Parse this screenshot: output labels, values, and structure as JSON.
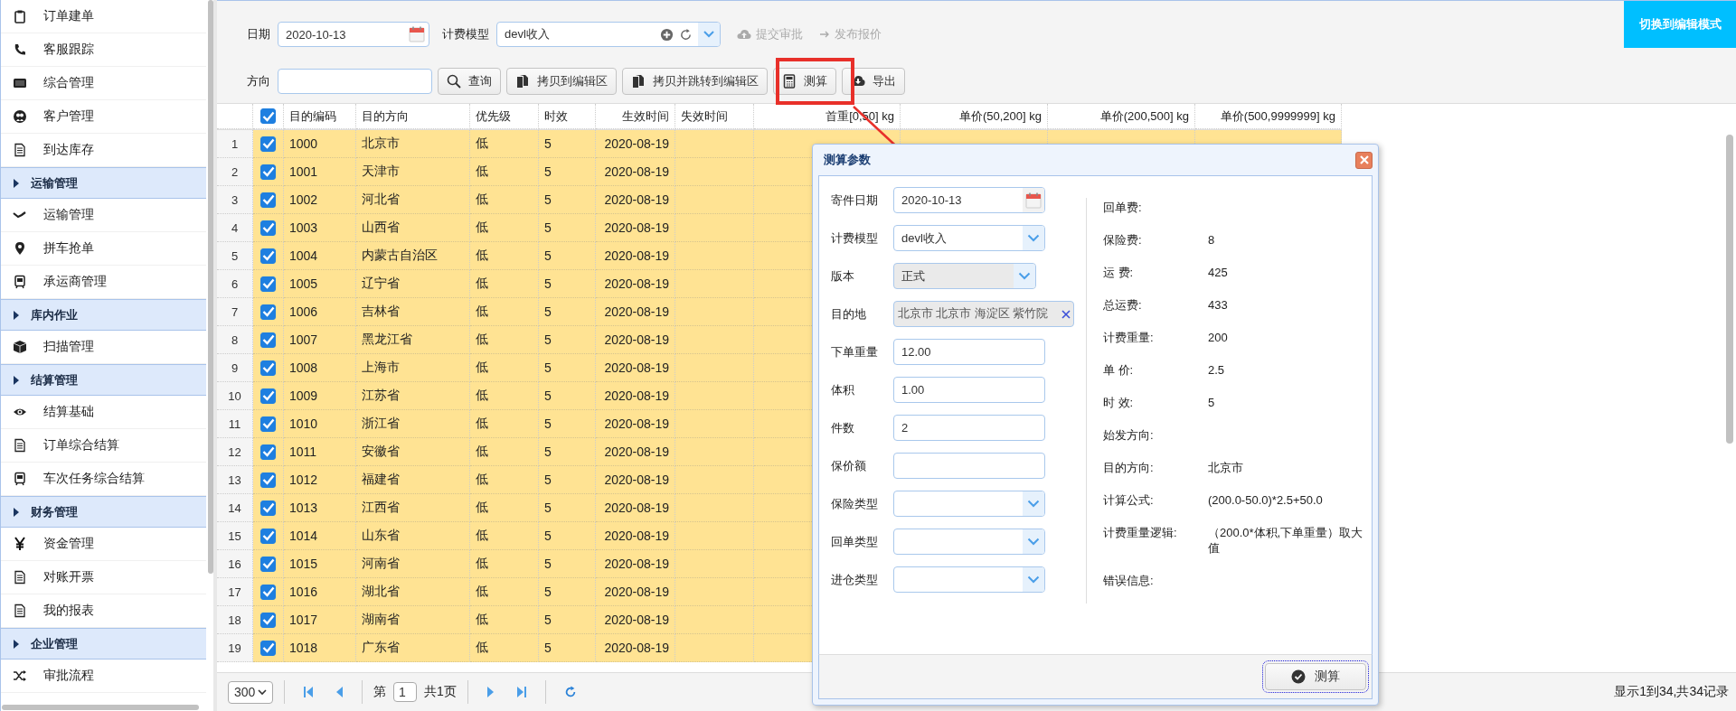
{
  "sidebar": {
    "items": [
      {
        "kind": "link",
        "label": "订单建单"
      },
      {
        "kind": "link",
        "label": "客服跟踪"
      },
      {
        "kind": "link",
        "label": "综合管理"
      },
      {
        "kind": "link",
        "label": "客户管理"
      },
      {
        "kind": "link",
        "label": "到达库存"
      },
      {
        "kind": "header",
        "label": "运输管理"
      },
      {
        "kind": "link",
        "label": "运输管理"
      },
      {
        "kind": "link",
        "label": "拼车抢单"
      },
      {
        "kind": "link",
        "label": "承运商管理"
      },
      {
        "kind": "header",
        "label": "库内作业"
      },
      {
        "kind": "link",
        "label": "扫描管理"
      },
      {
        "kind": "header",
        "label": "结算管理"
      },
      {
        "kind": "link",
        "label": "结算基础"
      },
      {
        "kind": "link",
        "label": "订单综合结算"
      },
      {
        "kind": "link",
        "label": "车次任务综合结算"
      },
      {
        "kind": "header",
        "label": "财务管理"
      },
      {
        "kind": "link",
        "label": "资金管理"
      },
      {
        "kind": "link",
        "label": "对账开票"
      },
      {
        "kind": "link",
        "label": "我的报表"
      },
      {
        "kind": "header",
        "label": "企业管理"
      },
      {
        "kind": "link",
        "label": "审批流程"
      }
    ]
  },
  "toolbar": {
    "date": {
      "label": "日期",
      "value": "2020-10-13"
    },
    "fee_model": {
      "label": "计费模型",
      "value": "devl收入"
    },
    "actions": [
      {
        "label": "提交审批",
        "disabled": true
      },
      {
        "label": "发布报价",
        "disabled": true
      }
    ],
    "direction": {
      "label": "方向"
    },
    "buttons": [
      {
        "label": "查询"
      },
      {
        "label": "拷贝到编辑区"
      },
      {
        "label": "拷贝并跳转到编辑区"
      },
      {
        "label": "测算",
        "highlighted": true
      },
      {
        "label": "导出"
      }
    ],
    "mode_button": "切换到编辑模式"
  },
  "table": {
    "select_all": true,
    "columns": [
      "目的编码",
      "目的方向",
      "优先级",
      "时效",
      "生效时间",
      "失效时间",
      "首重[0,50] kg",
      "单价(50,200] kg",
      "单价(200,500] kg",
      "单价(500,9999999] kg"
    ],
    "rows": [
      {
        "num": "1",
        "checked": true,
        "cells": [
          "1000",
          "北京市",
          "低",
          "5",
          "2020-08-19"
        ]
      },
      {
        "num": "2",
        "checked": true,
        "cells": [
          "1001",
          "天津市",
          "低",
          "5",
          "2020-08-19"
        ]
      },
      {
        "num": "3",
        "checked": true,
        "cells": [
          "1002",
          "河北省",
          "低",
          "5",
          "2020-08-19"
        ]
      },
      {
        "num": "4",
        "checked": true,
        "cells": [
          "1003",
          "山西省",
          "低",
          "5",
          "2020-08-19"
        ]
      },
      {
        "num": "5",
        "checked": true,
        "cells": [
          "1004",
          "内蒙古自治区",
          "低",
          "5",
          "2020-08-19"
        ]
      },
      {
        "num": "6",
        "checked": true,
        "cells": [
          "1005",
          "辽宁省",
          "低",
          "5",
          "2020-08-19"
        ]
      },
      {
        "num": "7",
        "checked": true,
        "cells": [
          "1006",
          "吉林省",
          "低",
          "5",
          "2020-08-19"
        ]
      },
      {
        "num": "8",
        "checked": true,
        "cells": [
          "1007",
          "黑龙江省",
          "低",
          "5",
          "2020-08-19"
        ]
      },
      {
        "num": "9",
        "checked": true,
        "cells": [
          "1008",
          "上海市",
          "低",
          "5",
          "2020-08-19"
        ]
      },
      {
        "num": "10",
        "checked": true,
        "cells": [
          "1009",
          "江苏省",
          "低",
          "5",
          "2020-08-19"
        ]
      },
      {
        "num": "11",
        "checked": true,
        "cells": [
          "1010",
          "浙江省",
          "低",
          "5",
          "2020-08-19"
        ]
      },
      {
        "num": "12",
        "checked": true,
        "cells": [
          "1011",
          "安徽省",
          "低",
          "5",
          "2020-08-19"
        ]
      },
      {
        "num": "13",
        "checked": true,
        "cells": [
          "1012",
          "福建省",
          "低",
          "5",
          "2020-08-19"
        ]
      },
      {
        "num": "14",
        "checked": true,
        "cells": [
          "1013",
          "江西省",
          "低",
          "5",
          "2020-08-19"
        ]
      },
      {
        "num": "15",
        "checked": true,
        "cells": [
          "1014",
          "山东省",
          "低",
          "5",
          "2020-08-19"
        ]
      },
      {
        "num": "16",
        "checked": true,
        "cells": [
          "1015",
          "河南省",
          "低",
          "5",
          "2020-08-19"
        ]
      },
      {
        "num": "17",
        "checked": true,
        "cells": [
          "1016",
          "湖北省",
          "低",
          "5",
          "2020-08-19"
        ]
      },
      {
        "num": "18",
        "checked": true,
        "cells": [
          "1017",
          "湖南省",
          "低",
          "5",
          "2020-08-19"
        ]
      },
      {
        "num": "19",
        "checked": true,
        "cells": [
          "1018",
          "广东省",
          "低",
          "5",
          "2020-08-19"
        ]
      }
    ]
  },
  "pager": {
    "page_size": "300",
    "page_prefix": "第",
    "page": "1",
    "page_total": "共1页",
    "summary": "显示1到34,共34记录"
  },
  "dialog": {
    "title": "测算参数",
    "fields": [
      {
        "kind": "date",
        "label": "寄件日期",
        "value": "2020-10-13"
      },
      {
        "kind": "select",
        "label": "计费模型",
        "value": "devl收入",
        "disabled": false
      },
      {
        "kind": "select",
        "label": "版本",
        "value": "正式",
        "disabled": true
      },
      {
        "kind": "tags",
        "label": "目的地",
        "value": "北京市 北京市 海淀区 紫竹院"
      },
      {
        "kind": "text",
        "label": "下单重量",
        "value": "12.00"
      },
      {
        "kind": "text",
        "label": "体积",
        "value": "1.00"
      },
      {
        "kind": "text",
        "label": "件数",
        "value": "2"
      },
      {
        "kind": "text",
        "label": "保价额"
      },
      {
        "kind": "select",
        "label": "保险类型",
        "disabled": false
      },
      {
        "kind": "select",
        "label": "回单类型",
        "disabled": false
      },
      {
        "kind": "select",
        "label": "进仓类型",
        "disabled": false
      }
    ],
    "results": [
      {
        "label": "回单费:"
      },
      {
        "label": "保险费:",
        "value": "8"
      },
      {
        "label": "运 费:",
        "value": "425"
      },
      {
        "label": "总运费:",
        "value": "433"
      },
      {
        "label": "计费重量:",
        "value": "200"
      },
      {
        "label": "单 价:",
        "value": "2.5"
      },
      {
        "label": "时 效:",
        "value": "5"
      },
      {
        "label": "始发方向:"
      },
      {
        "label": "目的方向:",
        "value": "北京市"
      },
      {
        "label": "计算公式:",
        "value": "(200.0-50.0)*2.5+50.0"
      },
      {
        "label": "计费重量逻辑:",
        "value": "（200.0*体积,下单重量）取大值"
      },
      {
        "label": "错误信息:"
      }
    ],
    "submit": "测算"
  }
}
